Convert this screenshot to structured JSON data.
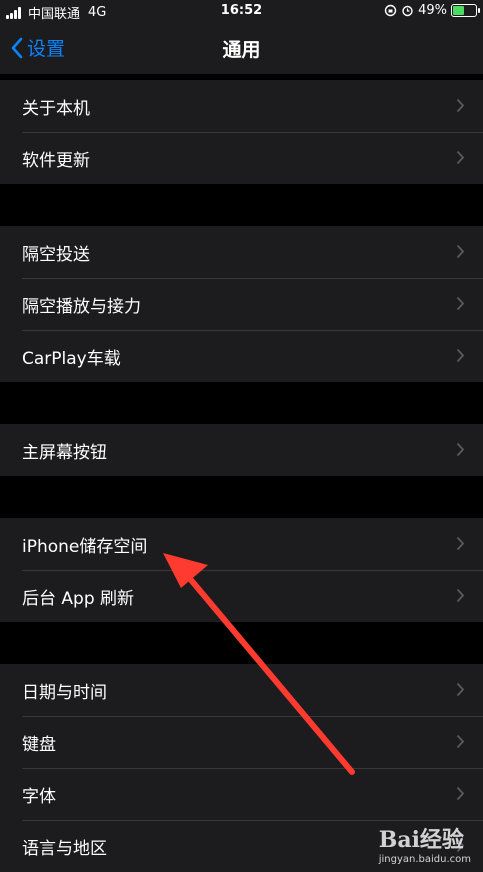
{
  "status": {
    "carrier": "中国联通",
    "network": "4G",
    "time": "16:52",
    "battery_percent": "49%",
    "battery_level": 0.49
  },
  "nav": {
    "back_label": "设置",
    "title": "通用"
  },
  "groups": [
    {
      "items": [
        {
          "label": "关于本机"
        },
        {
          "label": "软件更新"
        }
      ]
    },
    {
      "items": [
        {
          "label": "隔空投送"
        },
        {
          "label": "隔空播放与接力"
        },
        {
          "label": "CarPlay车载"
        }
      ]
    },
    {
      "items": [
        {
          "label": "主屏幕按钮"
        }
      ]
    },
    {
      "items": [
        {
          "label": "iPhone储存空间"
        },
        {
          "label": "后台 App 刷新"
        }
      ]
    },
    {
      "items": [
        {
          "label": "日期与时间"
        },
        {
          "label": "键盘"
        },
        {
          "label": "字体"
        },
        {
          "label": "语言与地区"
        }
      ]
    }
  ],
  "watermark": {
    "brand": "Bai经验",
    "url": "jingyan.baidu.com"
  },
  "colors": {
    "accent": "#0a84ff",
    "arrow": "#ff3b30",
    "cell": "#1c1c1e",
    "background": "#000000"
  }
}
